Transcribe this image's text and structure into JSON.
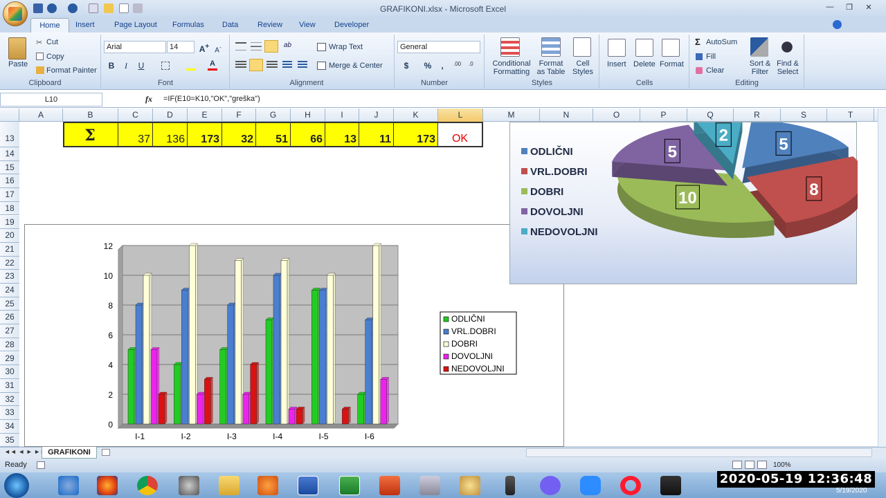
{
  "window": {
    "title": "GRAFIKONI.xlsx - Microsoft Excel"
  },
  "tabs": [
    "Home",
    "Insert",
    "Page Layout",
    "Formulas",
    "Data",
    "Review",
    "View",
    "Developer"
  ],
  "clipboard": {
    "paste": "Paste",
    "cut": "Cut",
    "copy": "Copy",
    "format_painter": "Format Painter",
    "label": "Clipboard"
  },
  "font": {
    "name": "Arial",
    "size": "14",
    "label": "Font",
    "bold": "B",
    "italic": "I",
    "underline": "U"
  },
  "alignment": {
    "wrap": "Wrap Text",
    "merge": "Merge & Center",
    "label": "Alignment"
  },
  "number": {
    "format": "General",
    "currency": "$",
    "percent": "%",
    "comma": ",",
    "label": "Number"
  },
  "styles": {
    "cond": [
      "Conditional",
      "Formatting"
    ],
    "table": [
      "Format",
      "as Table"
    ],
    "cell": [
      "Cell",
      "Styles"
    ],
    "label": "Styles"
  },
  "cells": {
    "insert": "Insert",
    "delete": "Delete",
    "format": "Format",
    "label": "Cells"
  },
  "editing": {
    "autosum": "AutoSum",
    "fill": "Fill",
    "clear": "Clear",
    "sort": [
      "Sort &",
      "Filter"
    ],
    "find": [
      "Find &",
      "Select"
    ],
    "label": "Editing"
  },
  "formula_bar": {
    "name_box": "L10",
    "fx": "fx",
    "formula": "=IF(E10=K10,\"OK\",\"greška\")"
  },
  "columns": [
    "A",
    "B",
    "C",
    "D",
    "E",
    "F",
    "G",
    "H",
    "I",
    "J",
    "K",
    "L",
    "M",
    "N",
    "O",
    "P",
    "Q",
    "R",
    "S",
    "T"
  ],
  "rows": [
    "13",
    "14",
    "15",
    "16",
    "17",
    "18",
    "19",
    "20",
    "21",
    "22",
    "23",
    "24",
    "25",
    "26",
    "27",
    "28",
    "29",
    "30",
    "31",
    "32",
    "33",
    "34",
    "35"
  ],
  "row13": {
    "sigma": "Σ",
    "c": "37",
    "d": "136",
    "e": "173",
    "f": "32",
    "g": "51",
    "h": "66",
    "i": "13",
    "j": "11",
    "k": "173",
    "l": "OK"
  },
  "bar_chart": {
    "yticks": [
      "0",
      "2",
      "4",
      "6",
      "8",
      "10",
      "12"
    ],
    "legend": [
      "ODLIČNI",
      "VRL.DOBRI",
      "DOBRI",
      "DOVOLJNI",
      "NEDOVOLJNI"
    ]
  },
  "chart_data": [
    {
      "type": "bar",
      "categories": [
        "I-1",
        "I-2",
        "I-3",
        "I-4",
        "I-5",
        "I-6"
      ],
      "ylim": [
        0,
        12
      ],
      "series": [
        {
          "name": "ODLIČNI",
          "color": "#22cc22",
          "values": [
            5,
            4,
            5,
            7,
            9,
            2
          ]
        },
        {
          "name": "VRL.DOBRI",
          "color": "#4a7fd0",
          "values": [
            8,
            9,
            8,
            10,
            9,
            7
          ]
        },
        {
          "name": "DOBRI",
          "color": "#ffffd8",
          "values": [
            10,
            12,
            11,
            11,
            10,
            12
          ]
        },
        {
          "name": "DOVOLJNI",
          "color": "#ee22ee",
          "values": [
            5,
            2,
            2,
            1,
            0,
            3
          ]
        },
        {
          "name": "NEDOVOLJNI",
          "color": "#dd1111",
          "values": [
            2,
            3,
            4,
            1,
            1,
            0
          ]
        }
      ]
    },
    {
      "type": "pie",
      "labels": [
        "ODLIČNI",
        "VRL.DOBRI",
        "DOBRI",
        "DOVOLJNI",
        "NEDOVOLJNI"
      ],
      "values": [
        5,
        8,
        10,
        5,
        2
      ],
      "colors": [
        "#4f81bd",
        "#c0504d",
        "#9bbb59",
        "#8064a2",
        "#4bacc6"
      ]
    }
  ],
  "sheet": {
    "tab": "GRAFIKONI"
  },
  "status": {
    "ready": "Ready",
    "zoom": "100%"
  },
  "clock": {
    "time": "2020-05-19  12:36:48",
    "date": "5/19/2020"
  }
}
